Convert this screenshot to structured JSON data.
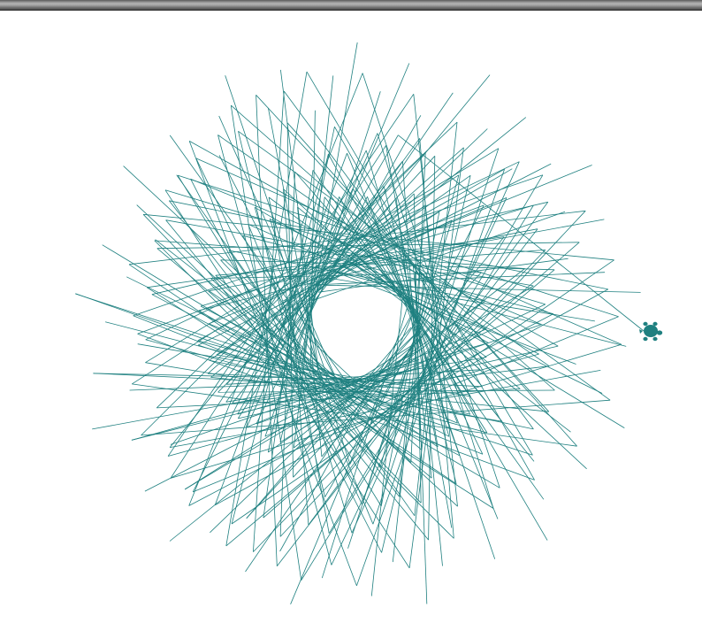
{
  "canvas": {
    "background": "#ffffff",
    "pen_color": "#1f8080",
    "turtle_color": "#1f8080",
    "turtle_icon": "turtle-icon"
  }
}
